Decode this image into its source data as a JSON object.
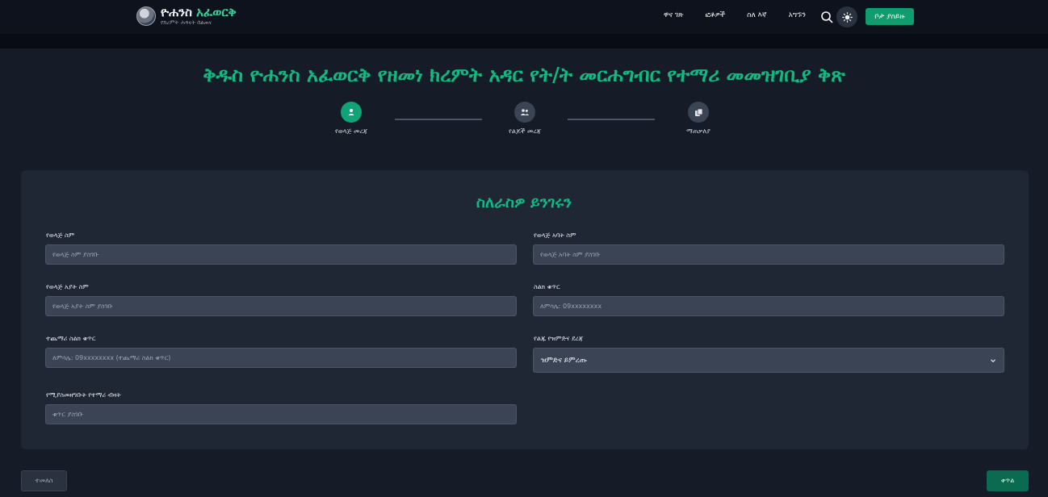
{
  "header": {
    "logo_title_main": "ዮሐንስ",
    "logo_title_accent": "አፈወርቅ",
    "logo_subtitle": "የክረምት ሕጻናት ሰልጠና",
    "nav": [
      "ዋና ገጽ",
      "ፎቶዎች",
      "ስለ እኛ",
      "አግኙን"
    ],
    "cta_label": "ቦታ ያስይዙ"
  },
  "page": {
    "title": "ቅዱስ ዮሐንስ አፈወርቅ የዘመነ ክረምት አዳር የት/ት መርሐግብር የተማሪ መመዝገቢያ ቅጽ"
  },
  "stepper": {
    "steps": [
      {
        "label": "የወላጅ መረጃ",
        "state": "active",
        "icon": "user-icon"
      },
      {
        "label": "የልጆች መረጃ",
        "state": "inactive",
        "icon": "users-icon"
      },
      {
        "label": "ማጠቃለያ",
        "state": "inactive",
        "icon": "summary-icon"
      }
    ]
  },
  "form": {
    "section_title": "ስለራስዎ ይንገሩን",
    "fields": {
      "parent_name": {
        "label": "የወላጅ ስም",
        "placeholder": "የወላጅ ስም ያስገቡ"
      },
      "parent_father_name": {
        "label": "የወላጅ አባት ስም",
        "placeholder": "የወላጅ አባት ስም ያስገቡ"
      },
      "parent_grandfather_name": {
        "label": "የወላጅ አያት ስም",
        "placeholder": "የወላጅ አያት ስም ያስገቡ"
      },
      "phone": {
        "label": "ስልክ ቁጥር",
        "placeholder": "ለምሳሌ: 09xxxxxxxx"
      },
      "extra_phone": {
        "label": "ተጨማሪ ስልክ ቁጥር",
        "placeholder": "ለምሳሌ: 09xxxxxxxx (ተጨማሪ ስልክ ቁጥር)"
      },
      "relation": {
        "label": "የልጁ የዝምድና ደረጃ",
        "selected": "ዝምድና ይምረጡ"
      },
      "student_count": {
        "label": "የሚያስመዘግቡት የተማሪ ብዛት",
        "placeholder": "ቁጥር ያስገቡ"
      }
    }
  },
  "footer": {
    "prev_label": "ተመለስ",
    "next_label": "ቀጥል"
  },
  "colors": {
    "accent": "#10b981",
    "background": "#151c28",
    "card": "#1f2734",
    "input": "#3b4454"
  }
}
